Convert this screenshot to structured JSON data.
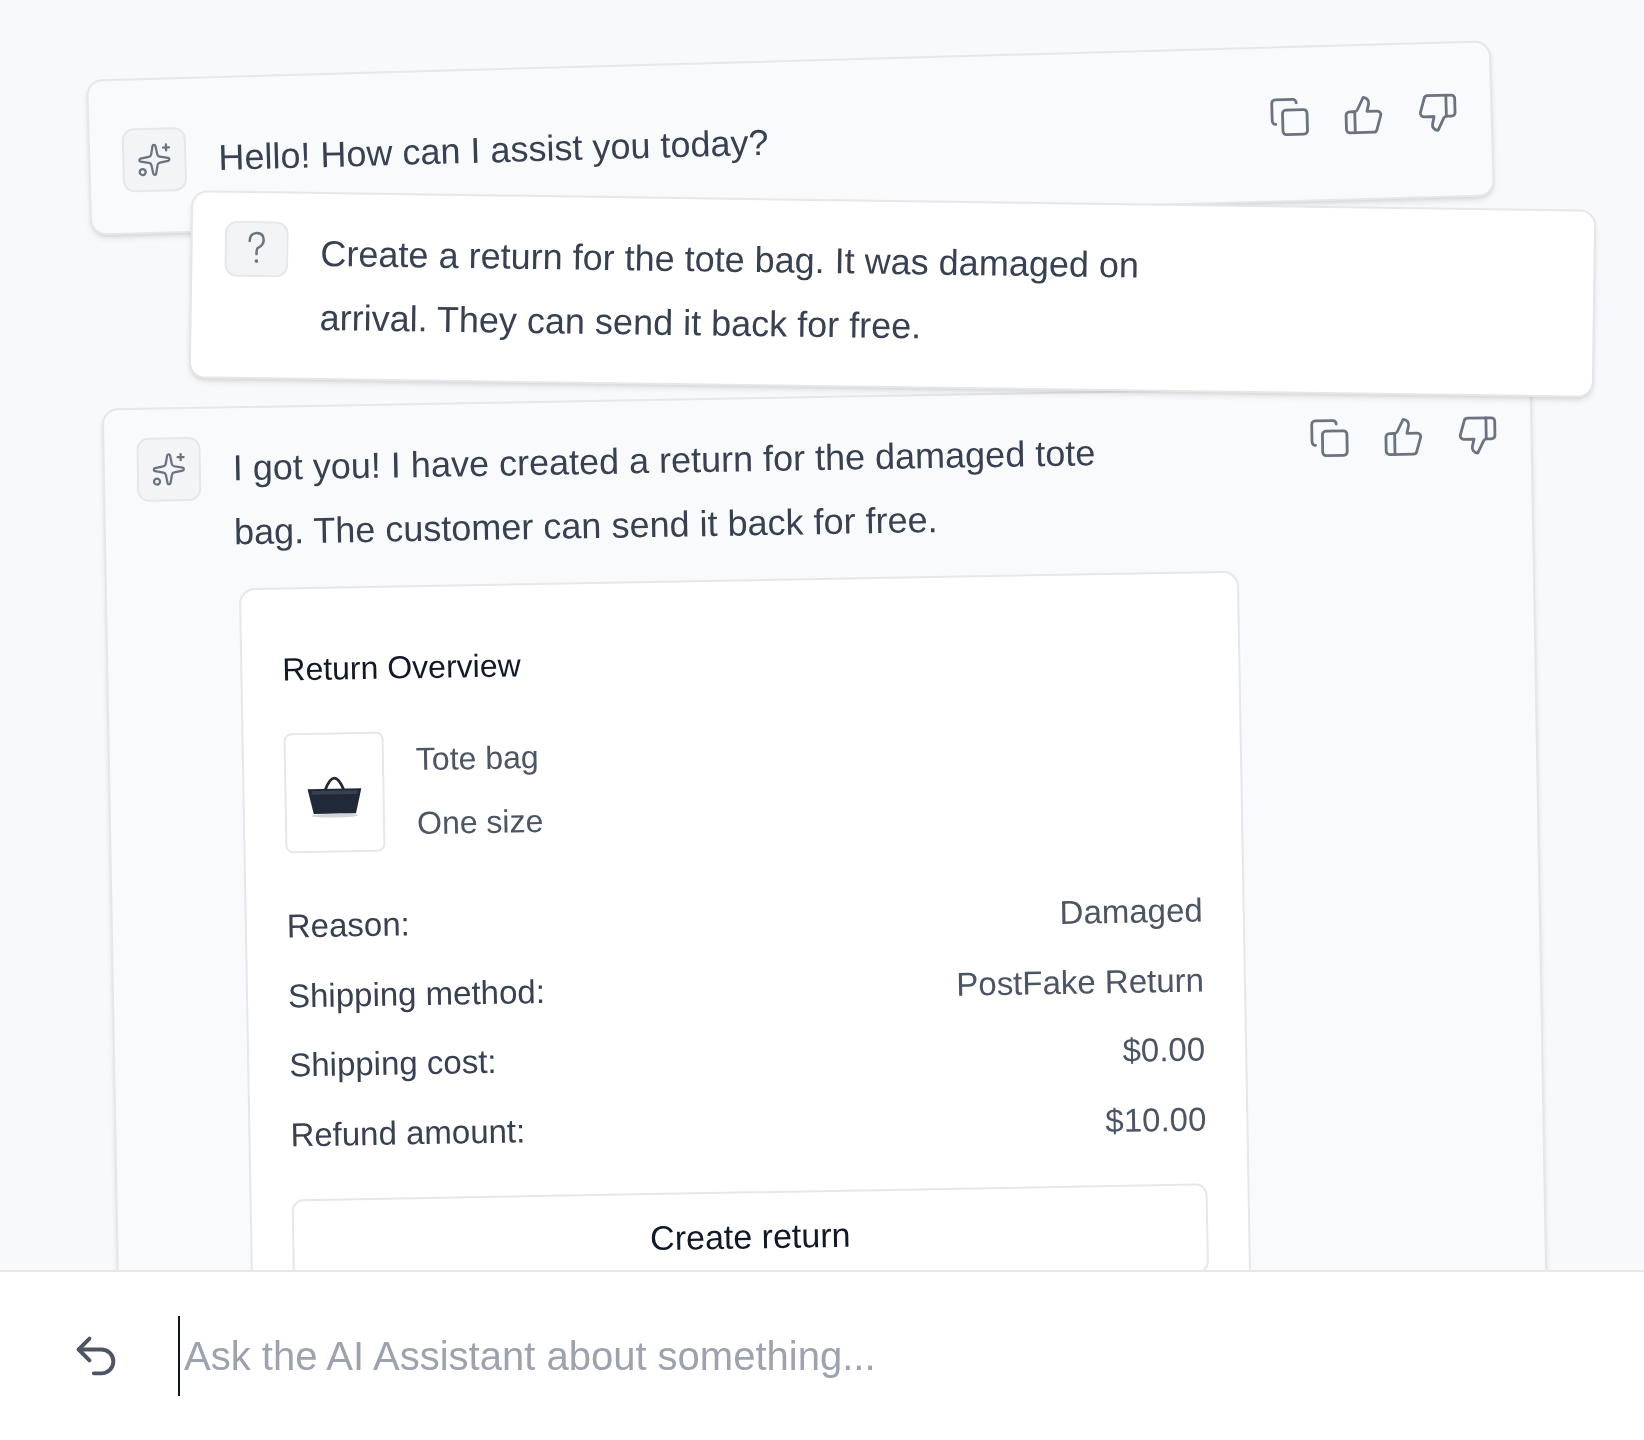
{
  "messages": [
    {
      "kind": "assistant",
      "text": "Hello! How can I assist you today?"
    },
    {
      "kind": "user",
      "text": "Create a return for the tote bag. It was damaged on arrival. They can send it back for free."
    },
    {
      "kind": "assistant",
      "text": "I got you! I have created a return for the damaged tote bag. The customer can send it back for free.",
      "card": {
        "title": "Return Overview",
        "product": {
          "name": "Tote bag",
          "variant": "One size"
        },
        "details": [
          {
            "label": "Reason:",
            "value": "Damaged"
          },
          {
            "label": "Shipping method:",
            "value": "PostFake Return"
          },
          {
            "label": "Shipping cost:",
            "value": "$0.00"
          },
          {
            "label": "Refund amount:",
            "value": "$10.00"
          }
        ],
        "button": "Create return"
      }
    }
  ],
  "composer": {
    "placeholder": "Ask the AI Assistant about something..."
  }
}
